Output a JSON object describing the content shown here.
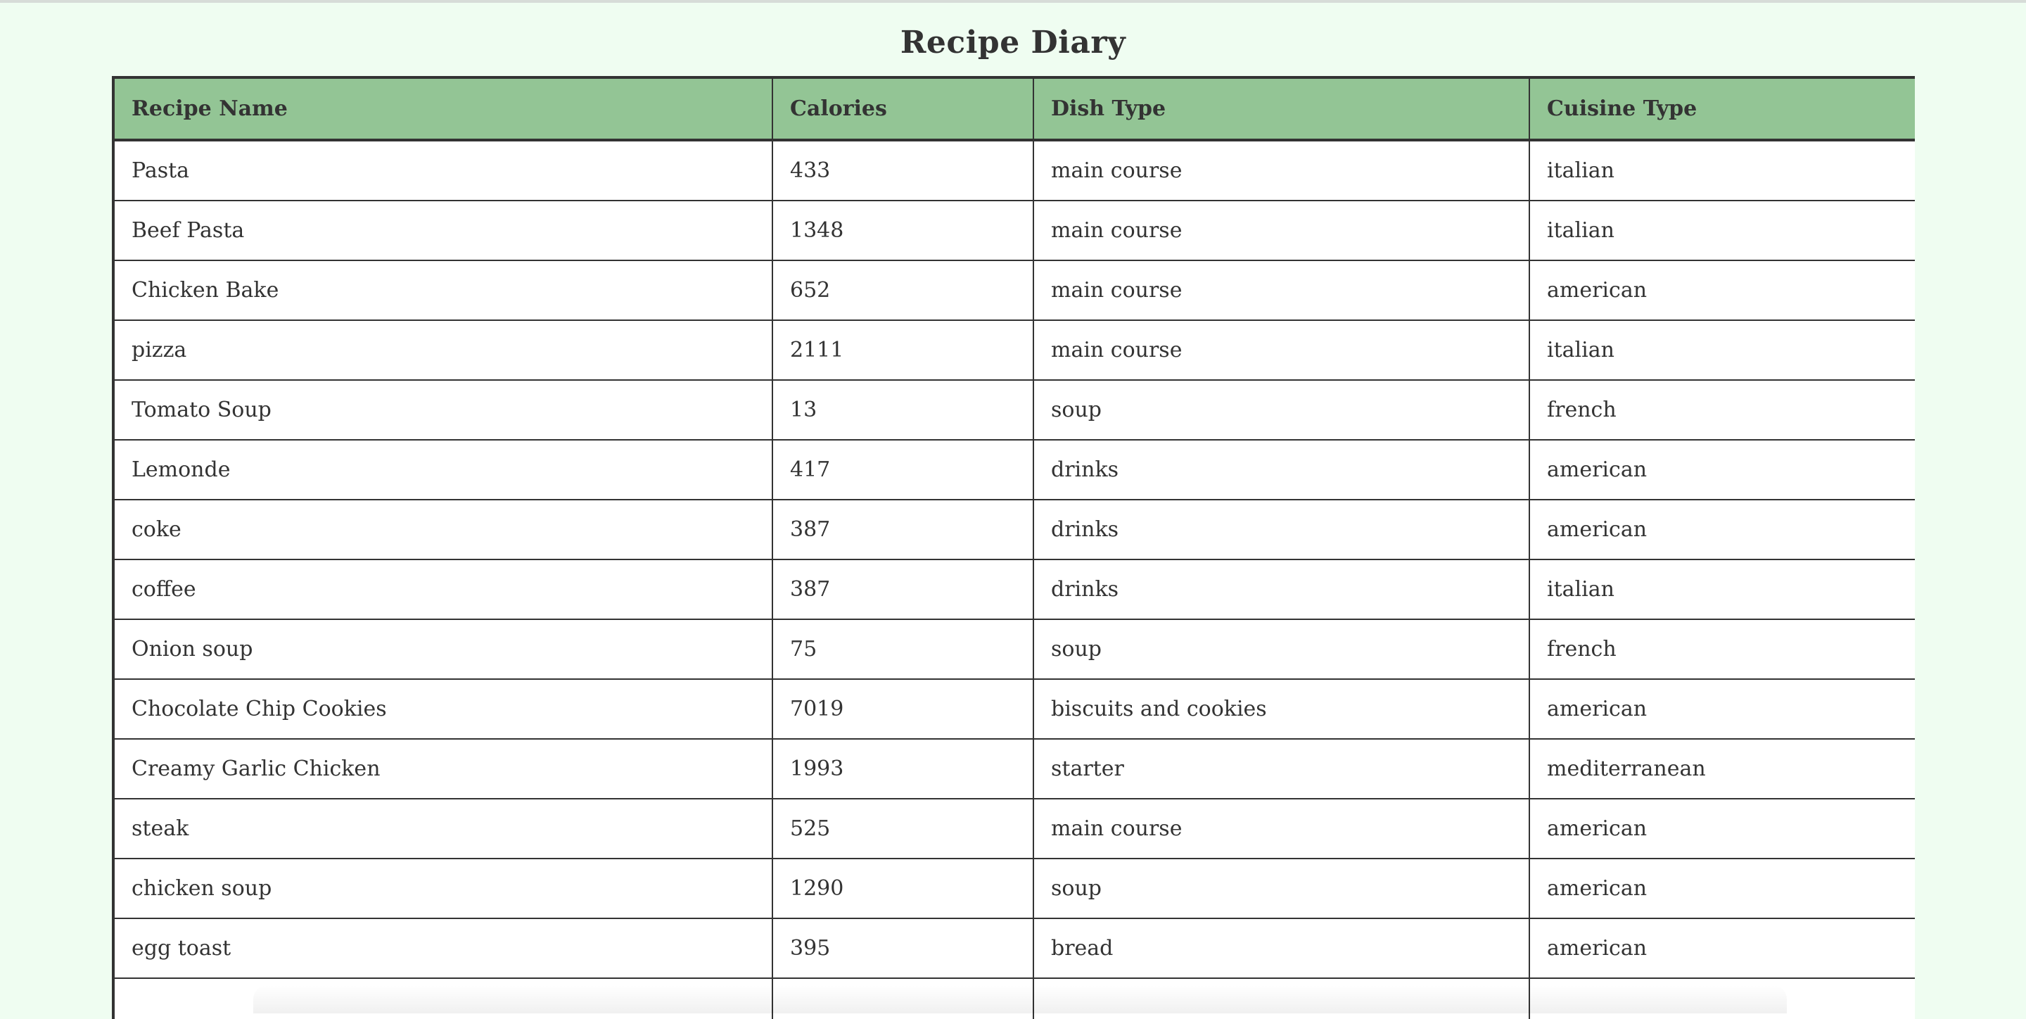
{
  "page": {
    "title": "Recipe Diary"
  },
  "table": {
    "headers": {
      "name": "Recipe Name",
      "calories": "Calories",
      "dish": "Dish Type",
      "cuisine": "Cuisine Type"
    },
    "rows": [
      {
        "name": "Pasta",
        "calories": "433",
        "dish": "main course",
        "cuisine": "italian"
      },
      {
        "name": "Beef Pasta",
        "calories": "1348",
        "dish": "main course",
        "cuisine": "italian"
      },
      {
        "name": "Chicken Bake",
        "calories": "652",
        "dish": "main course",
        "cuisine": "american"
      },
      {
        "name": "pizza",
        "calories": "2111",
        "dish": "main course",
        "cuisine": "italian"
      },
      {
        "name": "Tomato Soup",
        "calories": "13",
        "dish": "soup",
        "cuisine": "french"
      },
      {
        "name": "Lemonde",
        "calories": "417",
        "dish": "drinks",
        "cuisine": "american"
      },
      {
        "name": "coke",
        "calories": "387",
        "dish": "drinks",
        "cuisine": "american"
      },
      {
        "name": "coffee",
        "calories": "387",
        "dish": "drinks",
        "cuisine": "italian"
      },
      {
        "name": "Onion soup",
        "calories": "75",
        "dish": "soup",
        "cuisine": "french"
      },
      {
        "name": "Chocolate Chip Cookies",
        "calories": "7019",
        "dish": "biscuits and cookies",
        "cuisine": "american"
      },
      {
        "name": "Creamy Garlic Chicken",
        "calories": "1993",
        "dish": "starter",
        "cuisine": "mediterranean"
      },
      {
        "name": "steak",
        "calories": "525",
        "dish": "main course",
        "cuisine": "american"
      },
      {
        "name": "chicken soup",
        "calories": "1290",
        "dish": "soup",
        "cuisine": "american"
      },
      {
        "name": "egg toast",
        "calories": "395",
        "dish": "bread",
        "cuisine": "american"
      },
      {
        "name": "",
        "calories": "",
        "dish": "",
        "cuisine": ""
      }
    ]
  },
  "colors": {
    "page_background": "#effdf1",
    "header_background": "#93c595",
    "border": "#333333",
    "text": "#333333"
  }
}
